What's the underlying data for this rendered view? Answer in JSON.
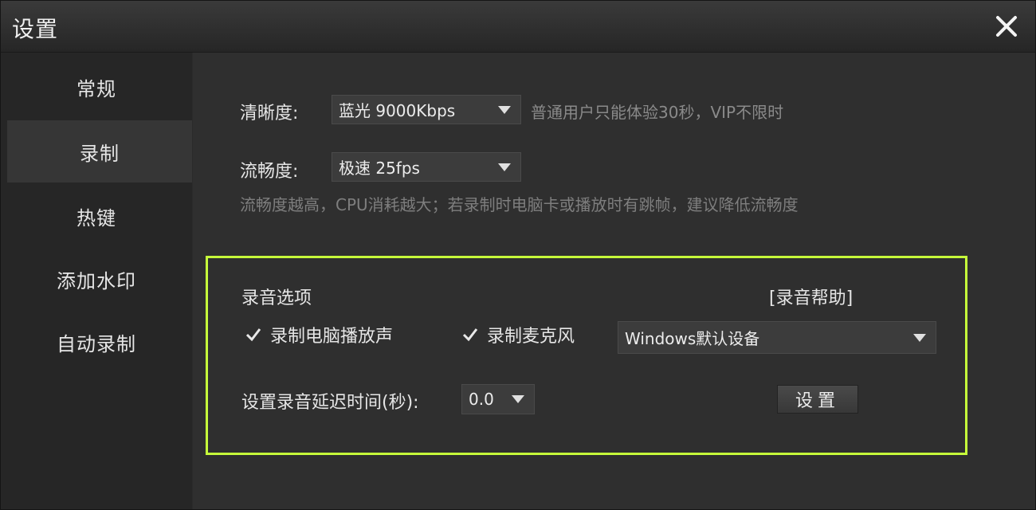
{
  "window": {
    "title": "设置"
  },
  "sidebar": {
    "items": [
      {
        "label": "常规",
        "active": false
      },
      {
        "label": "录制",
        "active": true
      },
      {
        "label": "热键",
        "active": false
      },
      {
        "label": "添加水印",
        "active": false
      },
      {
        "label": "自动录制",
        "active": false
      }
    ]
  },
  "clarity": {
    "label": "清晰度:",
    "value": "蓝光 9000Kbps",
    "note": "普通用户只能体验30秒，VIP不限时"
  },
  "fluency": {
    "label": "流畅度:",
    "value": "极速 25fps",
    "hint": "流畅度越高，CPU消耗越大；若录制时电脑卡或播放时有跳帧，建议降低流畅度"
  },
  "audio": {
    "title": "录音选项",
    "help_link": "[录音帮助]",
    "record_system_sound": {
      "label": "录制电脑播放声",
      "checked": true
    },
    "record_microphone": {
      "label": "录制麦克风",
      "checked": true
    },
    "device": {
      "value": "Windows默认设备"
    },
    "delay": {
      "label": "设置录音延迟时间(秒):",
      "value": "0.0"
    },
    "settings_button": "设置"
  },
  "colors": {
    "highlight_border": "#c6ff3a",
    "background": "#2f2f2f"
  }
}
